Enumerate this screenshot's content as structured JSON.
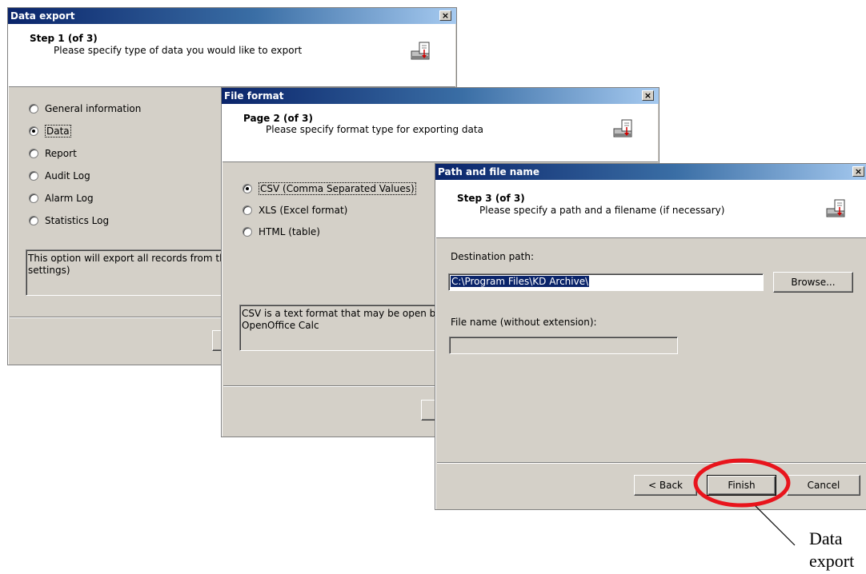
{
  "dialog1": {
    "title": "Data export",
    "close": "×",
    "step_title": "Step 1 (of 3)",
    "step_desc": "Please specify type of data you would like to export",
    "options": [
      {
        "label": "General information",
        "selected": false
      },
      {
        "label": "Data",
        "selected": true
      },
      {
        "label": "Report",
        "selected": false
      },
      {
        "label": "Audit Log",
        "selected": false
      },
      {
        "label": "Alarm Log",
        "selected": false
      },
      {
        "label": "Statistics Log",
        "selected": false
      }
    ],
    "info_line1": "This option will export all records from the",
    "info_line2": "settings)"
  },
  "dialog2": {
    "title": "File format",
    "close": "×",
    "step_title": "Page 2 (of 3)",
    "step_desc": "Please specify format type for exporting data",
    "options": [
      {
        "label": "CSV (Comma Separated Values)",
        "selected": true
      },
      {
        "label": "XLS (Excel format)",
        "selected": false
      },
      {
        "label": "HTML (table)",
        "selected": false
      }
    ],
    "info_line1": "CSV is a text format that may be open by",
    "info_line2": "OpenOffice Calc"
  },
  "dialog3": {
    "title": "Path and file name",
    "close": "×",
    "step_title": "Step 3 (of 3)",
    "step_desc": "Please specify a path and a filename (if necessary)",
    "dest_label": "Destination path:",
    "dest_value": "C:\\Program Files\\KD Archive\\",
    "browse_label": "Browse...",
    "filename_label": "File name (without extension):",
    "filename_value": "",
    "back_label": "< Back",
    "finish_label": "Finish",
    "cancel_label": "Cancel"
  },
  "annotation": {
    "line1": "Data",
    "line2": "export",
    "highlight_color": "#e8141c"
  },
  "colors": {
    "title_gradient_start": "#0a246a",
    "title_gradient_end": "#a6caf0",
    "dialog_face": "#d4d0c8"
  }
}
